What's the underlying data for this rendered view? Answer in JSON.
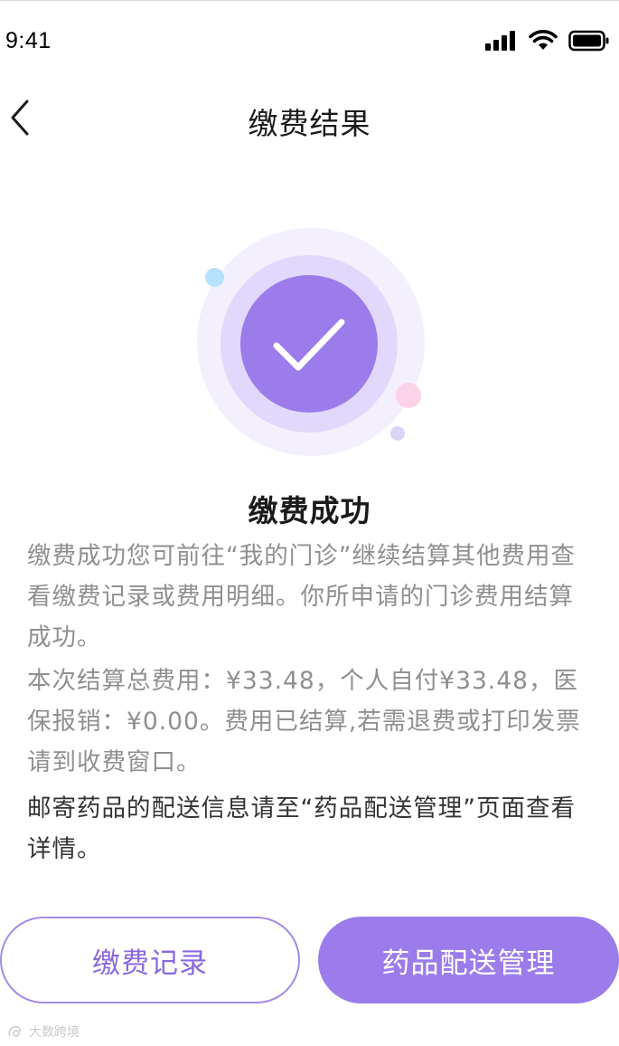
{
  "status_bar": {
    "time": "9:41"
  },
  "nav": {
    "title": "缴费结果",
    "back_icon": "chevron-left-icon"
  },
  "result": {
    "icon": "check-icon",
    "title": "缴费成功",
    "paragraph_1": "缴费成功您可前往“我的门诊”继续结算其他费用查看缴费记录或费用明细。你所申请的门诊费用结算成功。",
    "paragraph_2": "本次结算总费用：¥33.48，个人自付¥33.48，医保报销：¥0.00。费用已结算,若需退费或打印发票请到收费窗口。",
    "paragraph_3": "邮寄药品的配送信息请至“药品配送管理”页面查看详情。"
  },
  "actions": {
    "records_label": "缴费记录",
    "delivery_label": "药品配送管理"
  },
  "watermark": {
    "text": "大数跨境"
  },
  "colors": {
    "accent": "#9b7cea",
    "accent_text": "#8a68de",
    "muted_text": "#8f8f8f",
    "dark_text": "#333333"
  }
}
